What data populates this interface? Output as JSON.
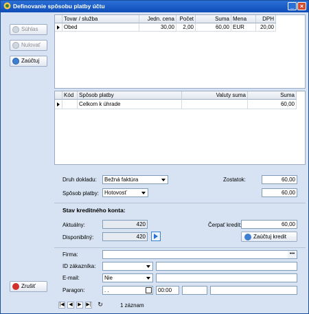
{
  "window": {
    "title": "Definovanie spôsobu platby účtu",
    "minimize_label": "_",
    "close_label": "×"
  },
  "left_buttons": {
    "suhlas": "Súhlas",
    "nulovat": "Nulovať",
    "zauctuj": "Zaúčtuj",
    "zrusit": "Zrušiť"
  },
  "items_grid": {
    "headers": [
      "Tovar / služba",
      "Jedn. cena",
      "Počet",
      "Suma",
      "Mena",
      "DPH"
    ],
    "rows": [
      {
        "tovar": "Obed",
        "jedn_cena": "30,00",
        "pocet": "2,00",
        "suma": "60,00",
        "mena": "EUR",
        "dph": "20,00"
      }
    ]
  },
  "payments_grid": {
    "headers": [
      "Kód",
      "Spôsob platby",
      "Valuty suma",
      "Suma"
    ],
    "rows": [
      {
        "kod": "",
        "sposob": "Celkom k úhrade",
        "valuty_suma": "",
        "suma": "60,00"
      }
    ]
  },
  "doc": {
    "druh_label": "Druh dokladu:",
    "druh_value": "Bežná faktúra",
    "sposob_label": "Spôsob platby:",
    "sposob_value": "Hotovosť",
    "zostatok_label": "Zostatok:",
    "zostatok_value": "60,00",
    "sposob_amount": "60,00"
  },
  "credit": {
    "title": "Stav kreditného konta:",
    "aktualny_label": "Aktuálny:",
    "aktualny_value": "420",
    "disponibilny_label": "Disponibilný:",
    "disponibilny_value": "420",
    "cerpat_label": "Čerpať kredit:",
    "cerpat_value": "60,00",
    "zauctuj_kredit": "Zaúčtuj kredit"
  },
  "customer": {
    "firma_label": "Firma:",
    "firma_value": "",
    "ellipsis": "•••",
    "id_label": "ID zákazníka:",
    "id_value": "",
    "id_extra": "",
    "email_label": "E-mail:",
    "email_value": "Nie",
    "email_extra": "",
    "paragon_label": "Paragon:",
    "paragon_date": ". .",
    "paragon_time": "00:00",
    "paragon_extra1": "",
    "paragon_extra2": ""
  },
  "nav": {
    "status": "1 záznam"
  }
}
